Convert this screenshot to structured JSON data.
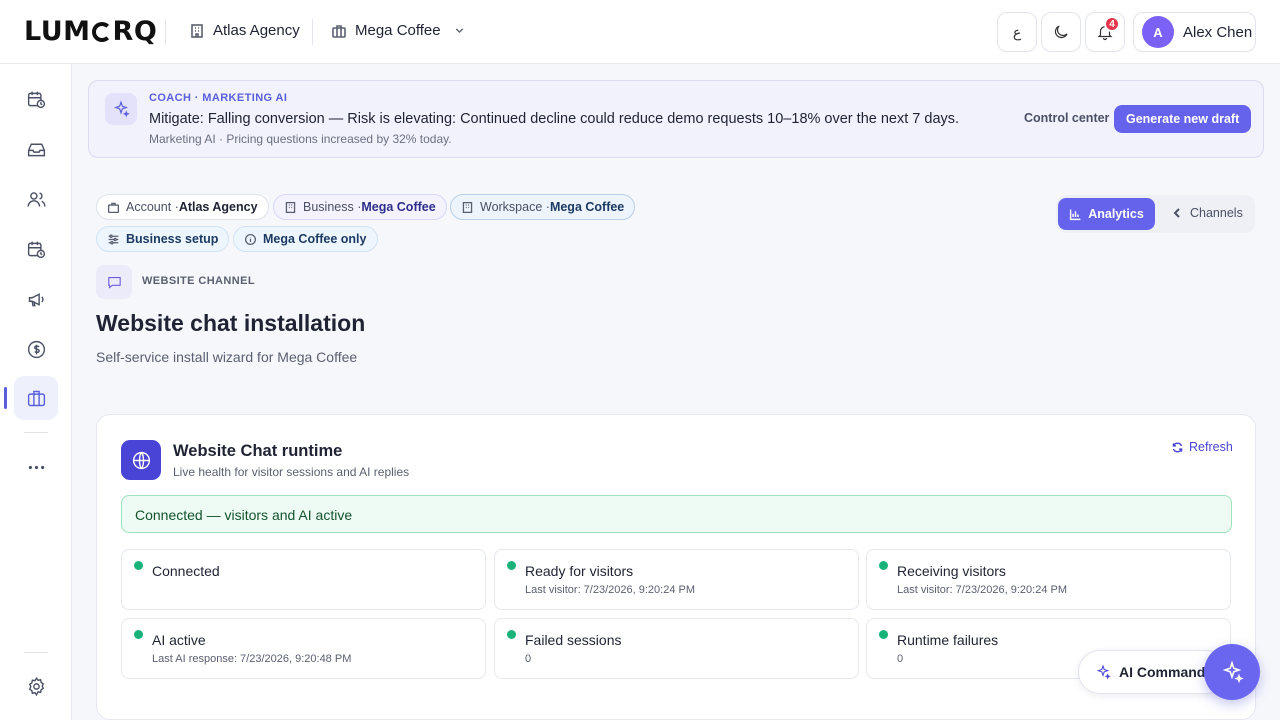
{
  "brand": {
    "logo_a": "LUM",
    "logo_b": "RQ"
  },
  "topbar": {
    "account": "Atlas Agency",
    "business": "Mega Coffee",
    "lang_btn": "ع",
    "notif_count": "4",
    "user_initial": "A",
    "user_name": "Alex Chen"
  },
  "coach": {
    "kicker": "COACH · MARKETING AI",
    "message": "Mitigate: Falling conversion — Risk is elevating: Continued decline could reduce demo requests 10–18% over the next 7 days.",
    "meta": "Marketing AI · Pricing questions increased by 32% today.",
    "control_center": "Control center",
    "generate": "Generate new draft"
  },
  "chips": {
    "account_label": "Account · ",
    "account_value": "Atlas Agency",
    "business_label": "Business · ",
    "business_value": "Mega Coffee",
    "workspace_label": "Workspace · ",
    "workspace_value": "Mega Coffee",
    "setup": "Business setup",
    "scope": "Mega Coffee only"
  },
  "segment": {
    "analytics": "Analytics",
    "channels": "Channels"
  },
  "channel": {
    "kicker": "WEBSITE CHANNEL",
    "title": "Website chat installation",
    "subtitle": "Self-service install wizard for Mega Coffee"
  },
  "runtime": {
    "title": "Website Chat runtime",
    "subtitle": "Live health for visitor sessions and AI replies",
    "refresh": "Refresh",
    "banner": "Connected — visitors and AI active",
    "stats": [
      {
        "label": "Connected",
        "value": ""
      },
      {
        "label": "Ready for visitors",
        "value": "Last visitor: 7/23/2026, 9:20:24 PM"
      },
      {
        "label": "Receiving visitors",
        "value": "Last visitor: 7/23/2026, 9:20:24 PM"
      },
      {
        "label": "AI active",
        "value": "Last AI response: 7/23/2026, 9:20:48 PM"
      },
      {
        "label": "Failed sessions",
        "value": "0"
      },
      {
        "label": "Runtime failures",
        "value": "0"
      }
    ],
    "status_color": "#19b37a"
  },
  "ai_command": {
    "label": "AI Command"
  },
  "colors": {
    "accent": "#6563ec",
    "success": "#19b37a",
    "danger": "#e5364b"
  }
}
